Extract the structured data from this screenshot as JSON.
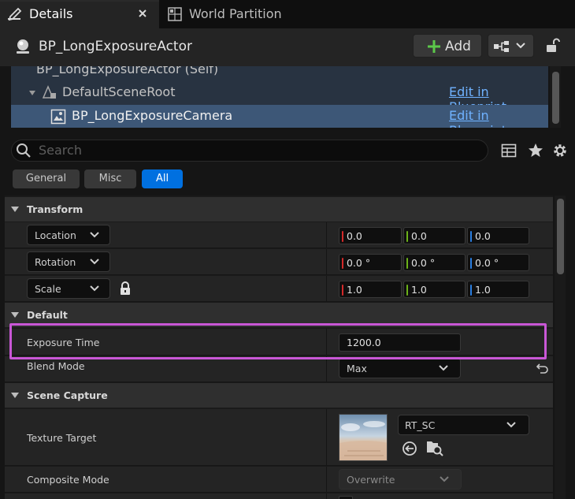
{
  "tabs": [
    {
      "label": "Details",
      "active": true
    },
    {
      "label": "World Partition",
      "active": false
    }
  ],
  "header": {
    "actor_name": "BP_LongExposureActor",
    "add_label": "Add"
  },
  "tree": {
    "items": [
      {
        "label": "BP_LongExposureActor (Self)",
        "action": ""
      },
      {
        "label": "DefaultSceneRoot",
        "action": "Edit in Blueprint"
      },
      {
        "label": "BP_LongExposureCamera",
        "action": "Edit in Blueprint",
        "selected": true
      }
    ]
  },
  "search": {
    "placeholder": "Search"
  },
  "filters": [
    {
      "label": "General",
      "active": false
    },
    {
      "label": "Misc",
      "active": false
    },
    {
      "label": "All",
      "active": true
    }
  ],
  "categories": {
    "transform": "Transform",
    "default": "Default",
    "scene_capture": "Scene Capture"
  },
  "transform": {
    "location": {
      "label": "Location",
      "x": "0.0",
      "y": "0.0",
      "z": "0.0"
    },
    "rotation": {
      "label": "Rotation",
      "x": "0.0 °",
      "y": "0.0 °",
      "z": "0.0 °"
    },
    "scale": {
      "label": "Scale",
      "x": "1.0",
      "y": "1.0",
      "z": "1.0"
    }
  },
  "defaults": {
    "exposure_time": {
      "label": "Exposure Time",
      "value": "1200.0"
    },
    "blend_mode": {
      "label": "Blend Mode",
      "value": "Max"
    }
  },
  "scene_capture": {
    "texture_target": {
      "label": "Texture Target",
      "value": "RT_SC"
    },
    "composite_mode": {
      "label": "Composite Mode",
      "value": "Overwrite"
    }
  },
  "colors": {
    "accent": "#0070e0",
    "link": "#6fb2ff",
    "highlight": "#c957d6",
    "axis_x": "#d42a2a",
    "axis_y": "#6cb21a",
    "axis_z": "#2a7ee0"
  }
}
